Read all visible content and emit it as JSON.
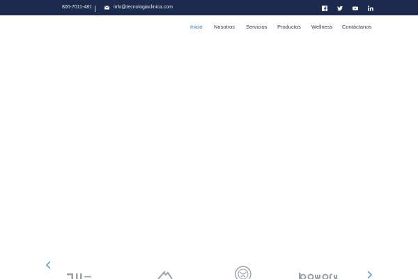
{
  "topbar": {
    "phone": "800-7011-481",
    "email": "info@tecnologiaclinica.com",
    "email_icon": "envelope-icon",
    "social": [
      {
        "name": "facebook-icon"
      },
      {
        "name": "twitter-icon"
      },
      {
        "name": "youtube-icon"
      },
      {
        "name": "linkedin-icon"
      }
    ]
  },
  "nav": {
    "items": [
      {
        "label": "Inicio",
        "active": true
      },
      {
        "label": "Nosotros"
      },
      {
        "label": "Servicios"
      },
      {
        "label": "Productos"
      },
      {
        "label": "Wellness"
      },
      {
        "label": "Contáctanos"
      }
    ]
  },
  "carousel": {
    "prev_icon": "chevron-left-icon",
    "next_icon": "chevron-right-icon"
  },
  "colors": {
    "topbar_bg": "#1c2b4d",
    "nav_active": "#2f6fb0",
    "nav_text": "#333a47",
    "arrow": "#4a8fd0",
    "logo_gray": "#9aa0a8"
  }
}
